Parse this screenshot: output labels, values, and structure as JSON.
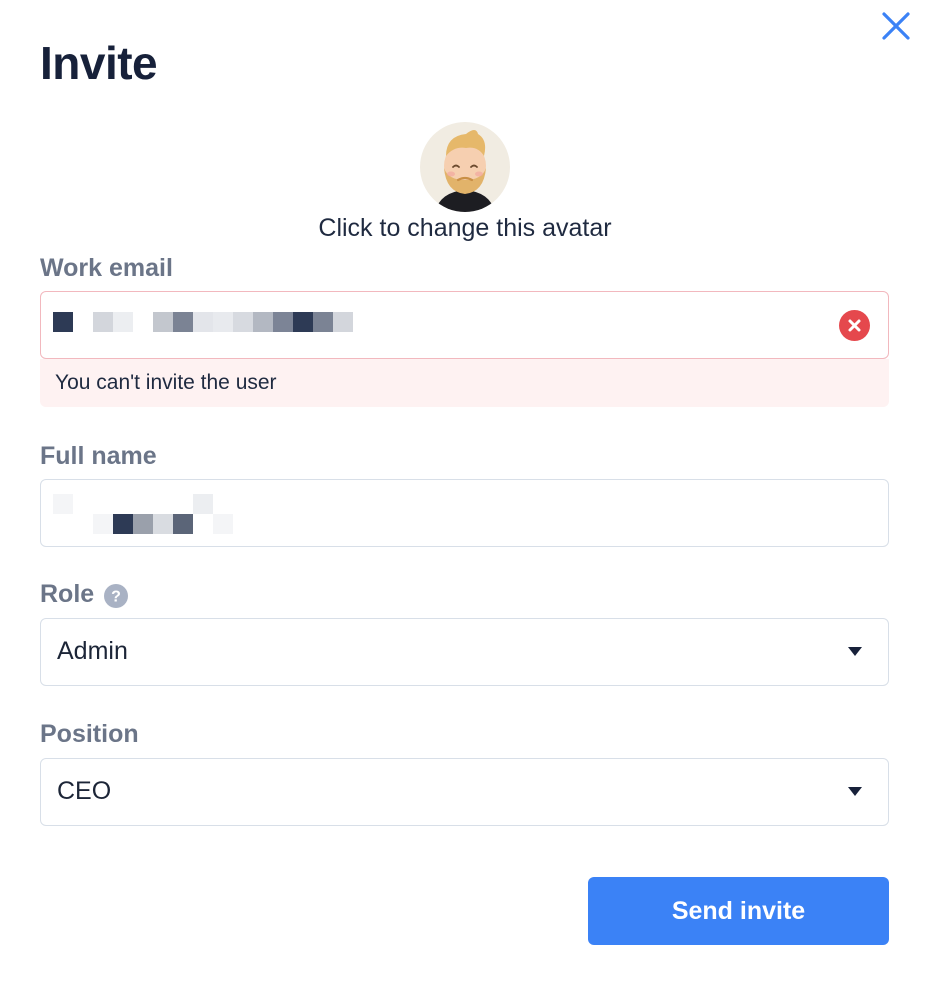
{
  "dialog": {
    "title": "Invite",
    "avatar": {
      "caption": "Click to change this avatar",
      "icon": "bearded-man-avatar"
    },
    "close_icon": "close-icon"
  },
  "form": {
    "work_email": {
      "label": "Work email",
      "value_redacted": true,
      "error": "You can't invite the user",
      "clear_icon": "clear-error-icon"
    },
    "full_name": {
      "label": "Full name",
      "value_redacted": true
    },
    "role": {
      "label": "Role",
      "help_icon": "question-circle-icon",
      "value": "Admin"
    },
    "position": {
      "label": "Position",
      "value": "CEO"
    }
  },
  "actions": {
    "send_label": "Send invite"
  },
  "colors": {
    "primary": "#3b82f6",
    "error": "#e5484d",
    "error_bg": "#fef2f2",
    "label": "#6b7588",
    "close": "#3b82f6"
  }
}
